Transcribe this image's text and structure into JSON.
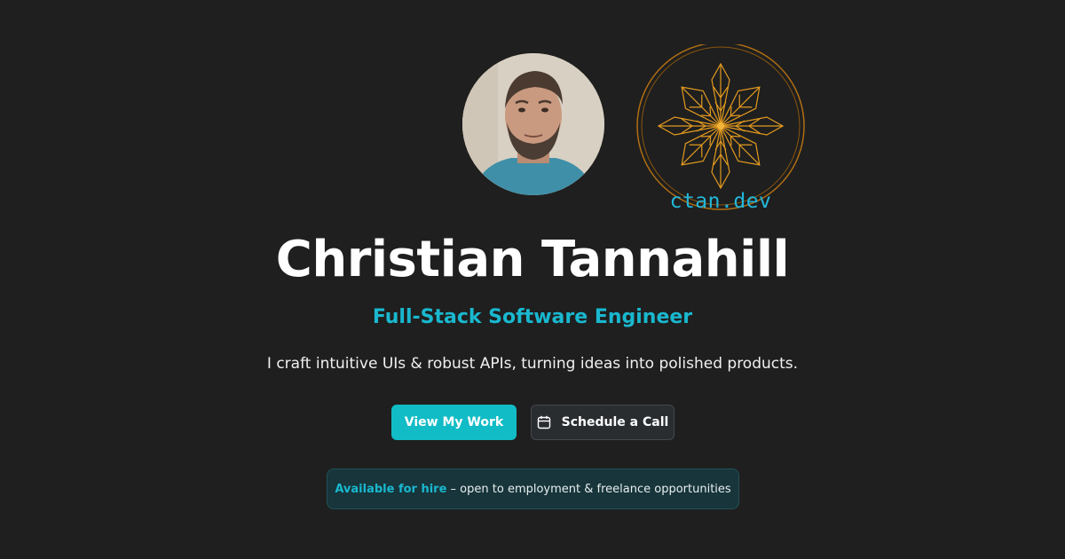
{
  "hero": {
    "name": "Christian Tannahill",
    "role": "Full-Stack Software Engineer",
    "tagline": "I craft intuitive UIs & robust APIs, turning ideas into polished products."
  },
  "logo": {
    "text": "ctan.dev"
  },
  "buttons": {
    "primary_label": "View My Work",
    "secondary_label": "Schedule a Call",
    "secondary_icon": "calendar-icon"
  },
  "banner": {
    "highlight": "Available for hire",
    "text": " – open to employment & freelance opportunities"
  },
  "colors": {
    "background": "#1f1f1f",
    "accent": "#19b8cf",
    "primary_button": "#12bcc6",
    "logo_gold": "#e39a1e"
  }
}
